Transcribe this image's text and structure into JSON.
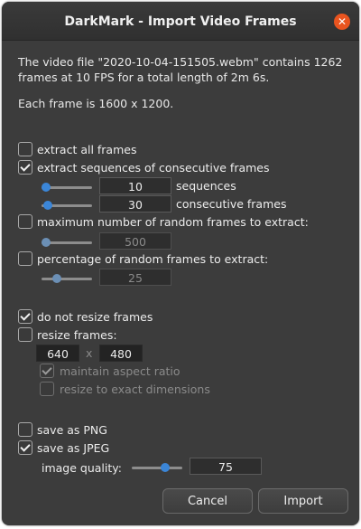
{
  "window": {
    "title": "DarkMark - Import Video Frames",
    "close_glyph": "✕",
    "accent_color": "#3b86d8",
    "close_color": "#e9541f"
  },
  "info": {
    "line1": "The video file \"2020-10-04-151505.webm\" contains 1262 frames at 10 FPS for a total length of 2m 6s.",
    "line2": "Each frame is 1600 x 1200."
  },
  "extract": {
    "all_frames": {
      "label": "extract all frames",
      "checked": false
    },
    "sequences": {
      "label": "extract sequences of consecutive frames",
      "checked": true,
      "sequences_value": "10",
      "sequences_label": "sequences",
      "sequences_slider_level": 0.05,
      "consecutive_value": "30",
      "consecutive_label": "consecutive frames",
      "consecutive_slider_level": 0.1
    },
    "max_random": {
      "label": "maximum number of random frames to extract:",
      "checked": false,
      "value": "500",
      "slider_level": 0.05
    },
    "percentage_random": {
      "label": "percentage of random frames to extract:",
      "checked": false,
      "value": "25",
      "slider_level": 0.25
    }
  },
  "resize": {
    "do_not_resize": {
      "label": "do not resize frames",
      "checked": true
    },
    "resize_frames": {
      "label": "resize frames:",
      "checked": false
    },
    "width": "640",
    "x_separator": "x",
    "height": "480",
    "maintain_aspect": {
      "label": "maintain aspect ratio",
      "checked": true
    },
    "exact_dimensions": {
      "label": "resize to exact dimensions",
      "checked": false
    }
  },
  "output": {
    "png": {
      "label": "save as PNG",
      "checked": false
    },
    "jpeg": {
      "label": "save as JPEG",
      "checked": true
    },
    "quality_label": "image quality:",
    "quality_value": "75",
    "quality_slider_level": 0.75
  },
  "buttons": {
    "cancel": "Cancel",
    "import": "Import"
  }
}
